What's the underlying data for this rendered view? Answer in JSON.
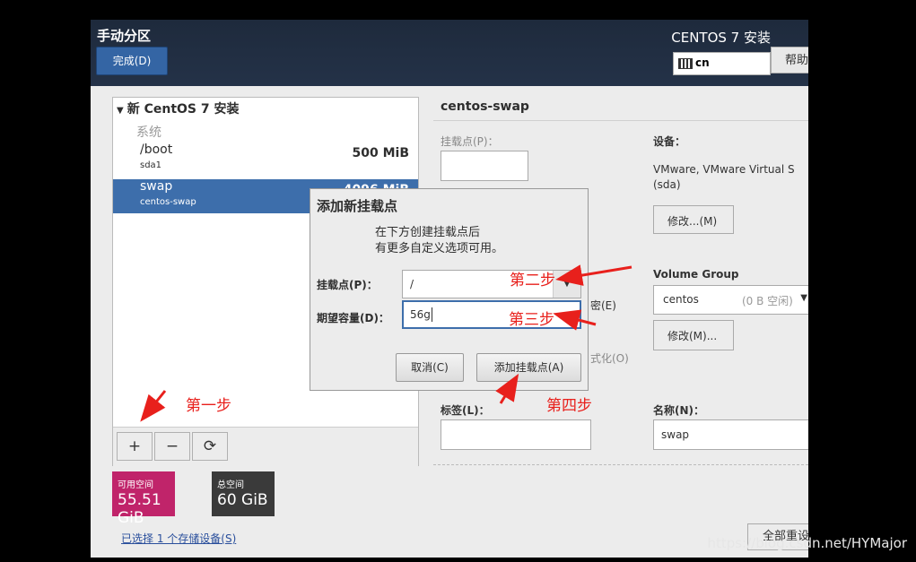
{
  "header": {
    "title": "手动分区",
    "done_button": "完成(D)",
    "os_title": "CENTOS 7 安装",
    "keyboard_layout": "cn",
    "help_button": "帮助"
  },
  "partition_tree": {
    "root_label": "新 CentOS 7 安装",
    "system_label": "系统",
    "items": [
      {
        "mount": "/boot",
        "device": "sda1",
        "size": "500 MiB"
      },
      {
        "mount": "swap",
        "device": "centos-swap",
        "size": "4096 MiB"
      }
    ],
    "selected_index": 1,
    "toolbar": {
      "add": "+",
      "remove": "−",
      "refresh": "⟳"
    }
  },
  "space": {
    "available_label": "可用空间",
    "available_value": "55.51 GiB",
    "available_color": "#c0246a",
    "total_label": "总空间",
    "total_value": "60 GiB",
    "total_color": "#3a3a3a",
    "storage_link": "已选择 1 个存储设备(S)"
  },
  "detail": {
    "title": "centos-swap",
    "mount_point_label": "挂载点(P)：",
    "device_label": "设备：",
    "device_text": "VMware, VMware Virtual S",
    "device_sub": "(sda)",
    "modify_button": "修改...(M)",
    "encrypt_partial": "密(E)",
    "format_partial": "式化(O)",
    "vg_label": "Volume Group",
    "vg_name": "centos",
    "vg_free": "(0 B 空闲)",
    "vg_modify_button": "修改(M)...",
    "tag_label": "标签(L)：",
    "name_label": "名称(N)：",
    "name_value": "swap",
    "reset_button": "全部重设"
  },
  "dialog": {
    "title": "添加新挂载点",
    "description_line1": "在下方创建挂载点后",
    "description_line2": "有更多自定义选项可用。",
    "mount_label": "挂载点(P)：",
    "mount_value": "/",
    "capacity_label": "期望容量(D)：",
    "capacity_value": "56g",
    "cancel_button": "取消(C)",
    "add_button": "添加挂载点(A)"
  },
  "annotations": {
    "step1": "第一步",
    "step2": "第二步",
    "step3": "第三步",
    "step4": "第四步",
    "color": "#e8201c"
  },
  "watermark": "https://blog.csdn.net/HYMajor"
}
